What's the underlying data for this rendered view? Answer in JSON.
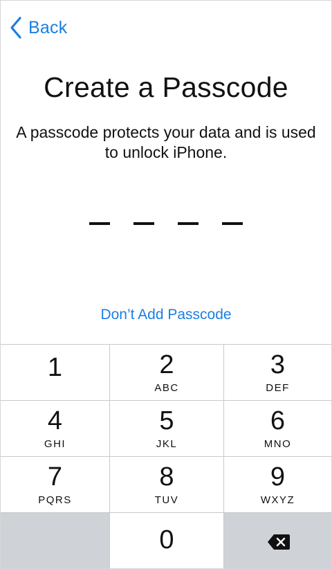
{
  "nav": {
    "back_label": "Back"
  },
  "header": {
    "title": "Create a Passcode",
    "subtitle": "A passcode protects your data and is used to unlock iPhone."
  },
  "passcode": {
    "length": 4,
    "entered": 0
  },
  "skip_label": "Don’t Add Passcode",
  "keypad": {
    "keys": [
      {
        "digit": "1",
        "letters": ""
      },
      {
        "digit": "2",
        "letters": "ABC"
      },
      {
        "digit": "3",
        "letters": "DEF"
      },
      {
        "digit": "4",
        "letters": "GHI"
      },
      {
        "digit": "5",
        "letters": "JKL"
      },
      {
        "digit": "6",
        "letters": "MNO"
      },
      {
        "digit": "7",
        "letters": "PQRS"
      },
      {
        "digit": "8",
        "letters": "TUV"
      },
      {
        "digit": "9",
        "letters": "WXYZ"
      },
      {
        "digit": "0",
        "letters": ""
      }
    ],
    "delete_icon": "delete-backspace-icon"
  },
  "colors": {
    "accent": "#1a7ee3",
    "keypad_gray": "#cfd2d6",
    "separator": "#c9c9c9"
  }
}
